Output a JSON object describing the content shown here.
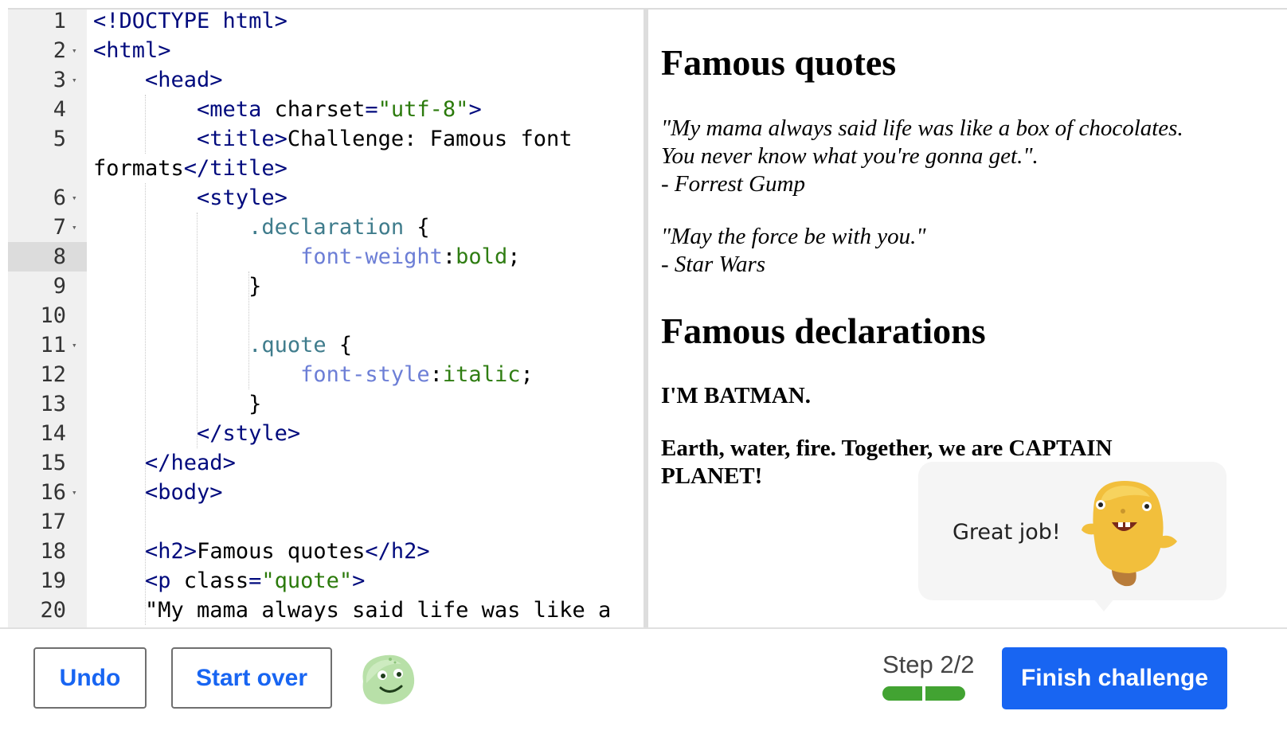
{
  "editor": {
    "line_numbers": [
      "1",
      "2",
      "3",
      "4",
      "5",
      "",
      "6",
      "7",
      "8",
      "9",
      "10",
      "11",
      "12",
      "13",
      "14",
      "15",
      "16",
      "17",
      "18",
      "19",
      "20"
    ],
    "fold_rows": [
      1,
      2,
      6,
      7,
      11,
      16
    ],
    "active_row": 8,
    "lines": [
      [
        {
          "t": "tag",
          "v": "<!DOCTYPE html>"
        }
      ],
      [
        {
          "t": "tag",
          "v": "<html>"
        }
      ],
      [
        {
          "t": "plain",
          "v": "    "
        },
        {
          "t": "tag",
          "v": "<head>"
        }
      ],
      [
        {
          "t": "plain",
          "v": "        "
        },
        {
          "t": "tag",
          "v": "<meta"
        },
        {
          "t": "plain",
          "v": " charset"
        },
        {
          "t": "tag",
          "v": "="
        },
        {
          "t": "str",
          "v": "\"utf-8\""
        },
        {
          "t": "tag",
          "v": ">"
        }
      ],
      [
        {
          "t": "plain",
          "v": "        "
        },
        {
          "t": "tag",
          "v": "<title>"
        },
        {
          "t": "plain",
          "v": "Challenge: Famous font"
        }
      ],
      [
        {
          "t": "plain",
          "v": "formats"
        },
        {
          "t": "tag",
          "v": "</title>"
        }
      ],
      [
        {
          "t": "plain",
          "v": "        "
        },
        {
          "t": "tag",
          "v": "<style>"
        }
      ],
      [
        {
          "t": "plain",
          "v": "            "
        },
        {
          "t": "sel",
          "v": ".declaration"
        },
        {
          "t": "plain",
          "v": " {"
        }
      ],
      [
        {
          "t": "plain",
          "v": "                "
        },
        {
          "t": "prop",
          "v": "font-weight"
        },
        {
          "t": "plain",
          "v": ":"
        },
        {
          "t": "val",
          "v": "bold"
        },
        {
          "t": "plain",
          "v": ";"
        }
      ],
      [
        {
          "t": "plain",
          "v": "            }"
        }
      ],
      [
        {
          "t": "plain",
          "v": ""
        }
      ],
      [
        {
          "t": "plain",
          "v": "            "
        },
        {
          "t": "sel",
          "v": ".quote"
        },
        {
          "t": "plain",
          "v": " {"
        }
      ],
      [
        {
          "t": "plain",
          "v": "                "
        },
        {
          "t": "prop",
          "v": "font-style"
        },
        {
          "t": "plain",
          "v": ":"
        },
        {
          "t": "val",
          "v": "italic"
        },
        {
          "t": "plain",
          "v": ";"
        }
      ],
      [
        {
          "t": "plain",
          "v": "            }"
        }
      ],
      [
        {
          "t": "plain",
          "v": "        "
        },
        {
          "t": "tag",
          "v": "</style>"
        }
      ],
      [
        {
          "t": "plain",
          "v": "    "
        },
        {
          "t": "tag",
          "v": "</head>"
        }
      ],
      [
        {
          "t": "plain",
          "v": "    "
        },
        {
          "t": "tag",
          "v": "<body>"
        }
      ],
      [
        {
          "t": "plain",
          "v": ""
        }
      ],
      [
        {
          "t": "plain",
          "v": "    "
        },
        {
          "t": "tag",
          "v": "<h2>"
        },
        {
          "t": "plain",
          "v": "Famous quotes"
        },
        {
          "t": "tag",
          "v": "</h2>"
        }
      ],
      [
        {
          "t": "plain",
          "v": "    "
        },
        {
          "t": "tag",
          "v": "<p"
        },
        {
          "t": "plain",
          "v": " class"
        },
        {
          "t": "tag",
          "v": "="
        },
        {
          "t": "str",
          "v": "\"quote\""
        },
        {
          "t": "tag",
          "v": ">"
        }
      ],
      [
        {
          "t": "plain",
          "v": "    \"My mama always said life was like a"
        }
      ],
      [
        {
          "t": "plain",
          "v": "box of chocolates. You never know what"
        }
      ]
    ]
  },
  "preview": {
    "heading_quotes": "Famous quotes",
    "quote1_line1": "\"My mama always said life was like a box of chocolates.",
    "quote1_line2": "You never know what you're gonna get.\".",
    "quote1_author": "- Forrest Gump",
    "quote2_line1": "\"May the force be with you.\"",
    "quote2_author": "- Star Wars",
    "heading_declarations": "Famous declarations",
    "decl1": "I'M BATMAN.",
    "decl2_line1": "Earth, water, fire. Together, we are CAPTAIN",
    "decl2_line2": "PLANET!"
  },
  "feedback": {
    "message": "Great job!",
    "mascot_icon": "yellow-monster-mascot"
  },
  "footer": {
    "undo_label": "Undo",
    "start_over_label": "Start over",
    "avatar_icon": "green-blob-avatar",
    "step_label": "Step 2/2",
    "progress_completed": 2,
    "progress_total": 2,
    "finish_label": "Finish challenge",
    "accent_color": "#1865f2",
    "progress_color": "#42a332"
  }
}
